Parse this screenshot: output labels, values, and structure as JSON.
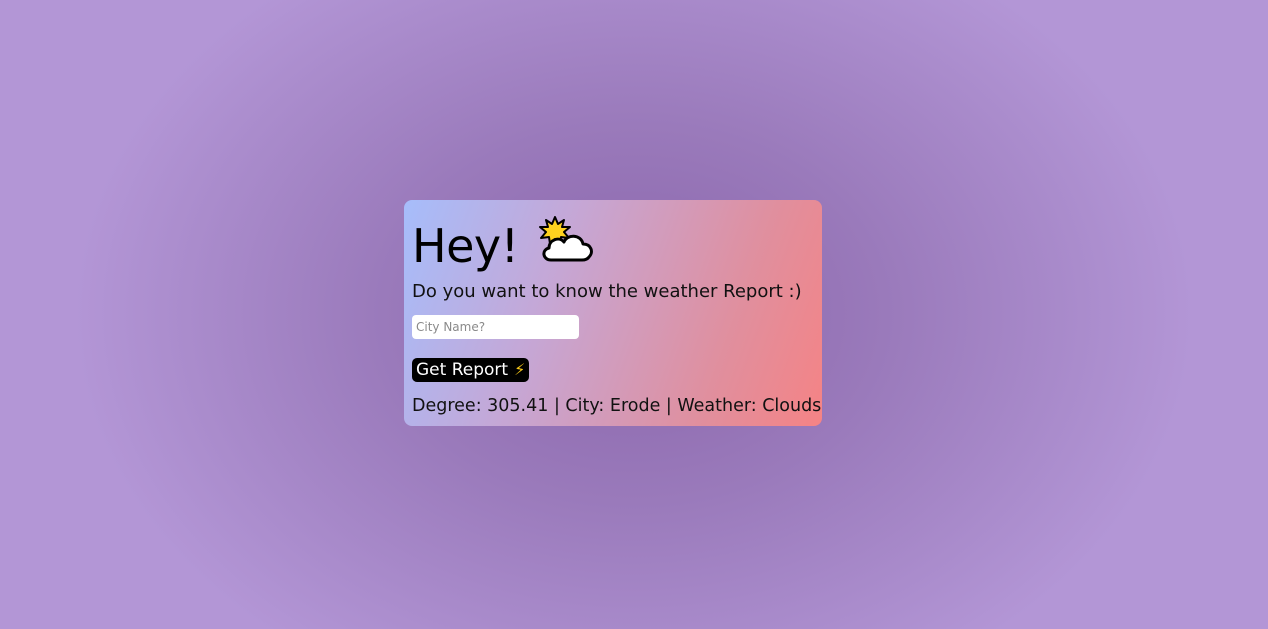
{
  "card": {
    "heading": "Hey!",
    "weather_icon": "sun-behind-cloud-icon",
    "subtitle": "Do you want to know the weather Report :)",
    "city_input": {
      "placeholder": "City Name?",
      "value": ""
    },
    "button": {
      "label": "Get Report",
      "icon": "⚡"
    },
    "result": "Degree: 305.41 | City: Erode | Weather: Clouds"
  },
  "colors": {
    "background": "#b396d6",
    "card_gradient_start": "#a6bdfb",
    "card_gradient_end": "#f58385",
    "button_bg": "#000000",
    "bolt": "#f5c518"
  }
}
